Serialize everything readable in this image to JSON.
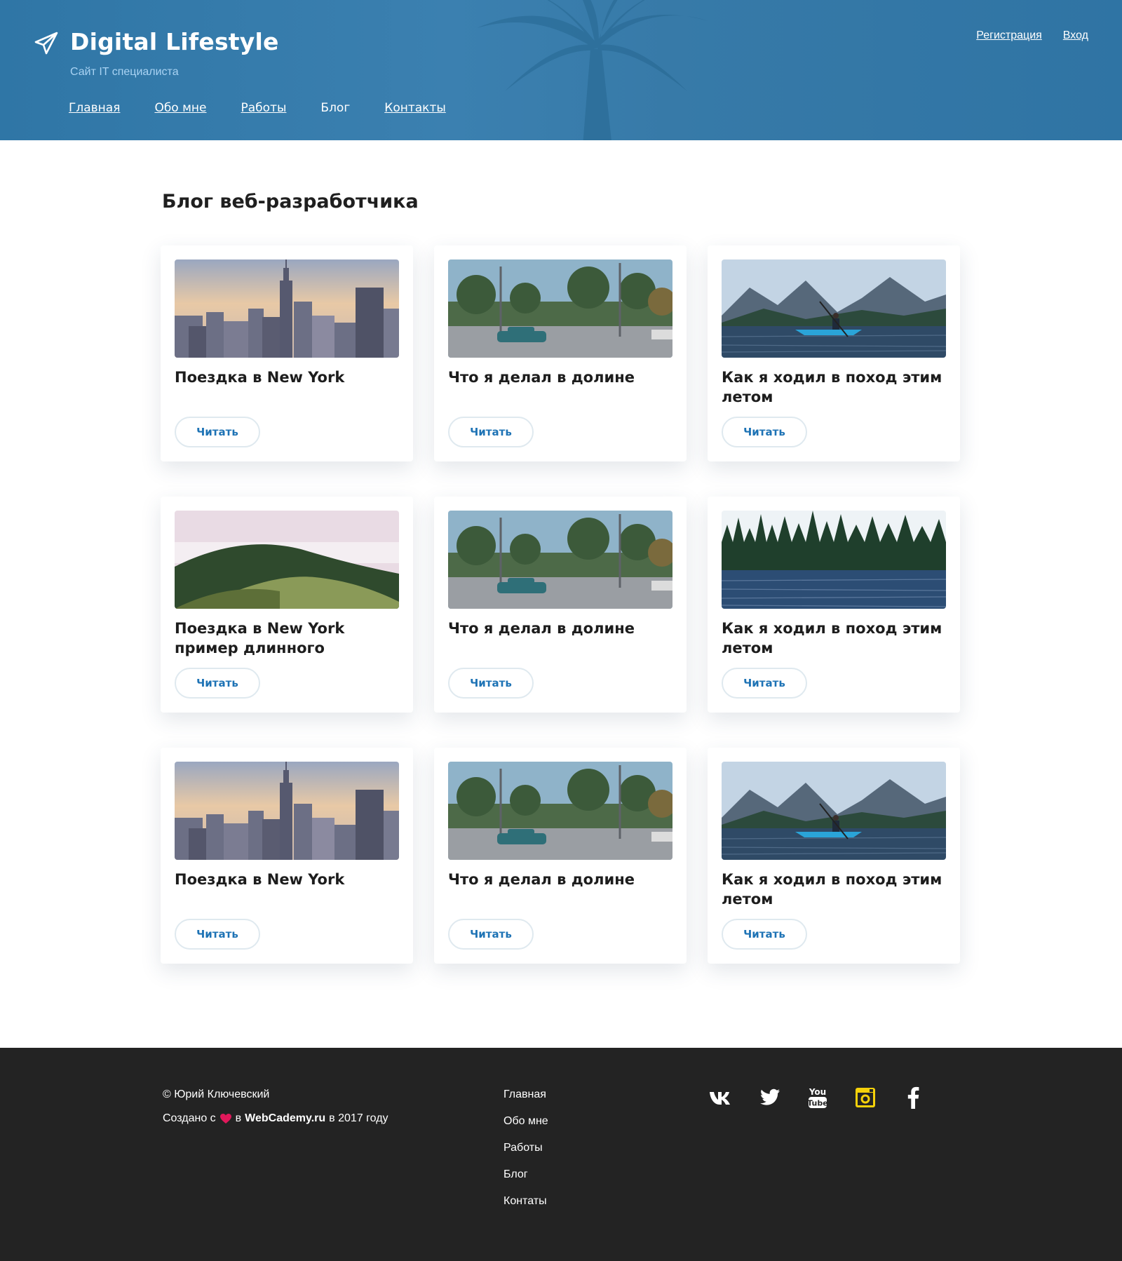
{
  "header": {
    "title": "Digital Lifestyle",
    "subtitle": "Сайт IT специалиста",
    "nav": [
      "Главная",
      "Обо мне",
      "Работы",
      "Блог",
      "Контакты"
    ],
    "auth": {
      "register": "Регистрация",
      "login": "Вход"
    }
  },
  "main": {
    "title": "Блог веб-разработчика",
    "read_label": "Читать",
    "posts": [
      {
        "title": "Поездка в New York",
        "image": "city"
      },
      {
        "title": "Что я делал в долине",
        "image": "street"
      },
      {
        "title": "Как я ходил в поход этим летом",
        "image": "kayak"
      },
      {
        "title": "Поездка в New York пример длинного названия поста ...",
        "image": "hills"
      },
      {
        "title": "Что я делал в долине",
        "image": "street"
      },
      {
        "title": "Как я ходил в поход этим летом",
        "image": "forest"
      },
      {
        "title": "Поездка в New York",
        "image": "city"
      },
      {
        "title": "Что я делал в долине",
        "image": "street"
      },
      {
        "title": "Как я ходил в поход этим летом",
        "image": "kayak"
      }
    ]
  },
  "footer": {
    "copyright": "© Юрий Ключевский",
    "made_prefix": "Создано с",
    "made_in": "в",
    "made_site": "WebCademy.ru",
    "made_suffix": "в 2017 году",
    "nav": [
      "Главная",
      "Обо мне",
      "Работы",
      "Блог",
      "Контаты"
    ],
    "social": [
      "vk-icon",
      "twitter-icon",
      "youtube-icon",
      "instagram-icon",
      "facebook-icon"
    ]
  },
  "colors": {
    "header_bg": "#3279a9",
    "accent": "#1e73b5",
    "footer_bg": "#232323",
    "instagram": "#f5d10a",
    "heart": "#e0185a"
  }
}
